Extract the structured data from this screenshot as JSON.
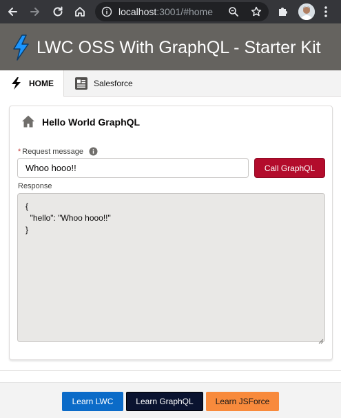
{
  "browser": {
    "url_host": "localhost",
    "url_rest": ":3001/#home"
  },
  "header": {
    "title": "LWC OSS With GraphQL - Starter Kit"
  },
  "tabs": [
    {
      "label": "HOME",
      "icon": "lightning-icon",
      "active": true
    },
    {
      "label": "Salesforce",
      "icon": "record-icon",
      "active": false
    }
  ],
  "card": {
    "title": "Hello World GraphQL",
    "request_label": "Request message",
    "required_mark": "*",
    "request_value": "Whoo hooo!!",
    "call_button": "Call GraphQL",
    "response_label": "Response",
    "response_text": "{\n  \"hello\": \"Whoo hooo!!\"\n}"
  },
  "footer": {
    "buttons": [
      {
        "label": "Learn LWC",
        "color": "#0b6bc8"
      },
      {
        "label": "Learn GraphQL",
        "color": "#0a1330"
      },
      {
        "label": "Learn JSForce",
        "color": "#f88a3c"
      }
    ]
  },
  "colors": {
    "header_bg": "#65635f",
    "call_button_bg": "#b30c2c",
    "logo_blue": "#1b96ff"
  }
}
